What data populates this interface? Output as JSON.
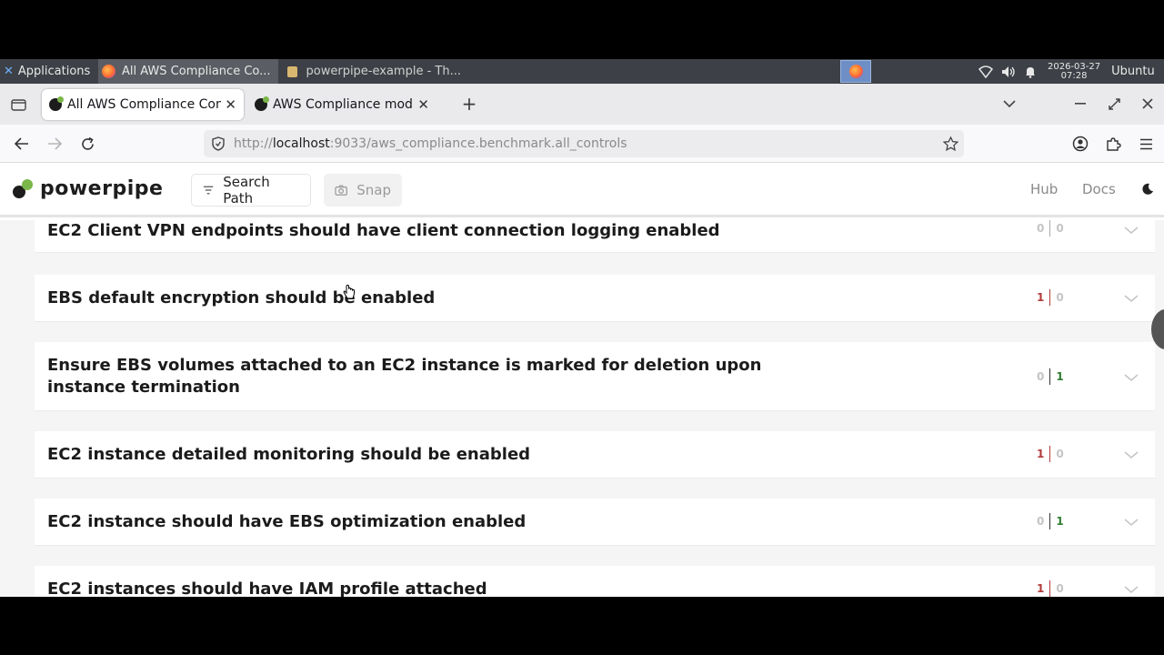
{
  "taskbar": {
    "apps_label": "Applications",
    "window1": "All AWS Compliance Co...",
    "window2": "powerpipe-example - Th...",
    "clock_date": "2026-03-27",
    "clock_time": "07:28",
    "user": "Ubuntu"
  },
  "browser": {
    "tabs": [
      {
        "label": "All AWS Compliance Cont",
        "active": true
      },
      {
        "label": "AWS Compliance mod | P",
        "active": false
      }
    ],
    "url_prefix": "http://",
    "url_host": "localhost",
    "url_rest": ":9033/aws_compliance.benchmark.all_controls"
  },
  "app": {
    "logo_text": "powerpipe",
    "search_path_label": "Search Path",
    "snap_label": "Snap",
    "hub_label": "Hub",
    "docs_label": "Docs"
  },
  "controls": [
    {
      "title": "EC2 Client VPN endpoints should have client connection logging enabled",
      "alarm": "0",
      "ok": "0"
    },
    {
      "title": "EBS default encryption should be enabled",
      "alarm": "1",
      "ok": "0"
    },
    {
      "title": "Ensure EBS volumes attached to an EC2 instance is marked for deletion upon instance termination",
      "alarm": "0",
      "ok": "1"
    },
    {
      "title": "EC2 instance detailed monitoring should be enabled",
      "alarm": "1",
      "ok": "0"
    },
    {
      "title": "EC2 instance should have EBS optimization enabled",
      "alarm": "0",
      "ok": "1"
    },
    {
      "title": "EC2 instances should have IAM profile attached",
      "alarm": "1",
      "ok": "0"
    }
  ],
  "colors": {
    "alarm": "#b33a3a",
    "ok": "#2e7d32",
    "zero": "#c4c4c4",
    "brand_green": "#7ab648"
  }
}
